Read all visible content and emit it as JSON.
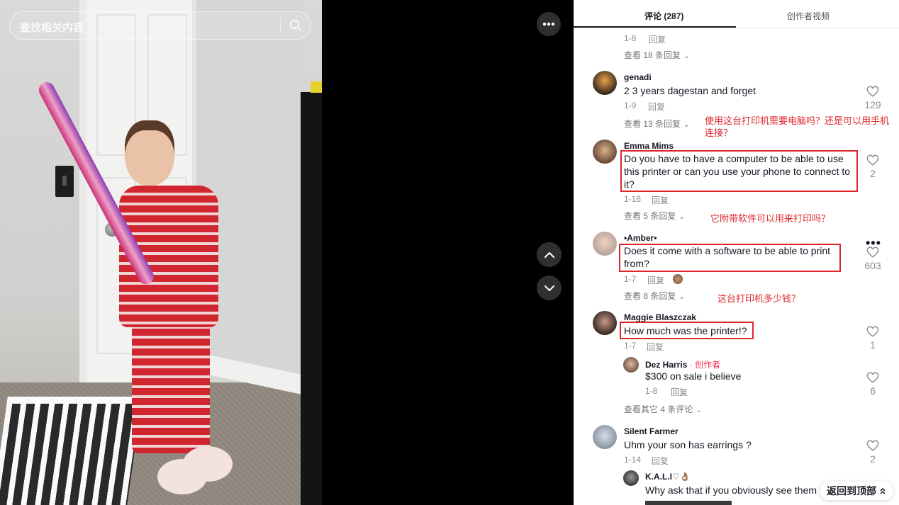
{
  "search": {
    "placeholder": "查找相关内容"
  },
  "tabs": [
    {
      "label": "评论 (287)"
    },
    {
      "label": "创作者视频"
    }
  ],
  "top_thread": {
    "time": "1-8",
    "reply": "回复",
    "view_replies": "查看 18 条回复"
  },
  "comments": [
    {
      "user": "genadi",
      "text": "2 3 years dagestan and forget",
      "time": "1-9",
      "reply": "回复",
      "likes": "129",
      "view_replies": "查看 13 条回复"
    },
    {
      "user": "Emma Mims",
      "text": "Do you have to have a computer to be able to use this printer or can you use your phone to connect to it?",
      "time": "1-16",
      "reply": "回复",
      "likes": "2",
      "view_replies": "查看 5 条回复"
    },
    {
      "user": "•Amber•",
      "text": "Does it come with a software to be able to print from?",
      "time": "1-7",
      "reply": "回复",
      "likes": "603",
      "view_replies": "查看 8 条回复"
    },
    {
      "user": "Maggie Blaszczak",
      "text": "How much was the printer!?",
      "time": "1-7",
      "reply": "回复",
      "likes": "1",
      "reply_item": {
        "user": "Dez Harris",
        "creator_label": " · 创作者",
        "text": "$300 on sale i believe",
        "time": "1-8",
        "reply": "回复",
        "likes": "6"
      },
      "view_more": "查看其它 4 条评论"
    },
    {
      "user": "Silent Farmer",
      "text": "Uhm your son has earrings ?",
      "time": "1-14",
      "reply": "回复",
      "likes": "2",
      "reply_item": {
        "user": "K.A.L.I♡👌🏽",
        "text": "Why ask that if you obviously see them"
      }
    }
  ],
  "annotations": {
    "emma": "使用这台打印机需要电脑吗？还是可以用手机连接？",
    "amber": "它附带软件可以用来打印吗？",
    "maggie": "这台打印机多少钱？"
  },
  "back_to_top": "返回到顶部",
  "colors": {
    "accent_red": "#e0262d",
    "creator_pink": "#fe2c55",
    "text": "#161823",
    "muted": "#8a8b91"
  }
}
